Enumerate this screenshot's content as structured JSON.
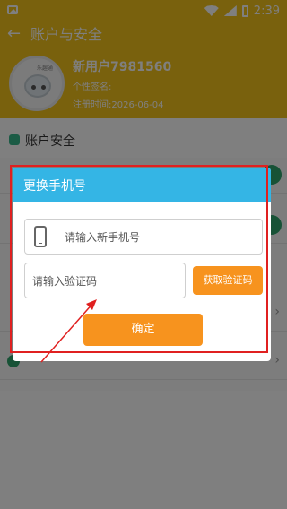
{
  "status_bar": {
    "time": "2:39"
  },
  "app_bar": {
    "title": "账户与安全"
  },
  "profile": {
    "avatar_text": "乐趣通",
    "nickname": "新用户7981560",
    "signature_label": "个性签名:",
    "register_label": "注册时间:",
    "register_date": "2026-06-04"
  },
  "section": {
    "title": "账户安全"
  },
  "colors": {
    "accent_yellow": "#f3c31b",
    "dialog_title": "#34b5e5",
    "button_orange": "#f7931e",
    "annotation_red": "#e02020"
  },
  "dialog": {
    "title": "更换手机号",
    "phone_placeholder": "请输入新手机号",
    "code_placeholder": "请输入验证码",
    "get_code_label": "获取验证码",
    "confirm_label": "确定"
  },
  "icons": [
    "image-icon",
    "wifi-icon",
    "signal-icon",
    "battery-icon",
    "back-arrow-icon",
    "shield-icon",
    "phone-icon",
    "chevron-right-icon"
  ]
}
